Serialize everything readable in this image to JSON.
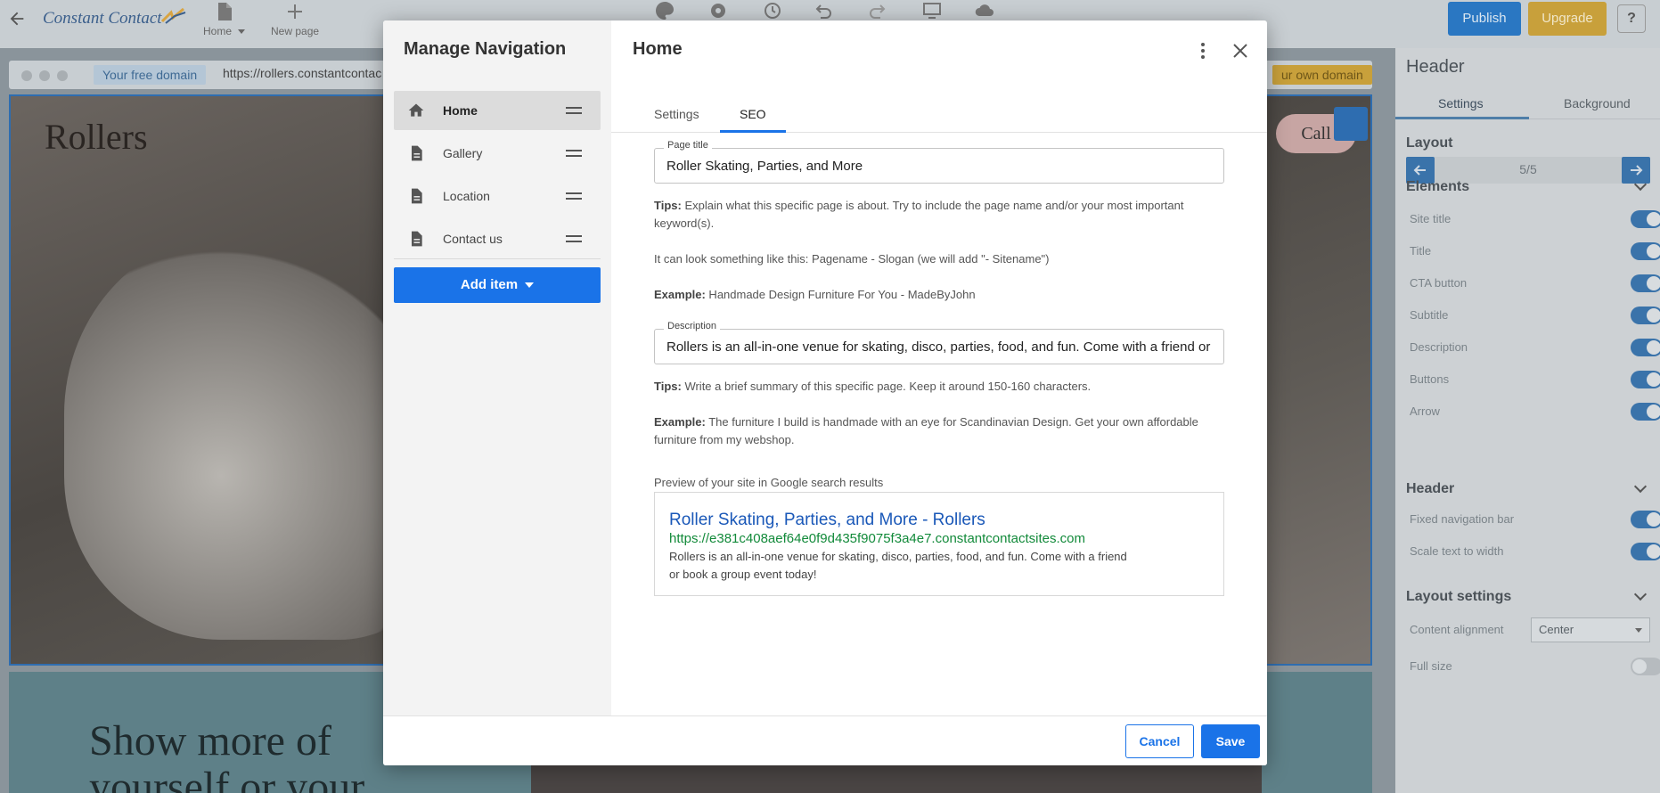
{
  "toolbar": {
    "logo_text": "Constant Contact",
    "page_menu_label": "Home",
    "new_page_label": "New page",
    "publish_label": "Publish",
    "upgrade_label": "Upgrade",
    "help_label": "?"
  },
  "canvas": {
    "free_domain_label": "Your free domain",
    "url": "https://rollers.constantcontac",
    "own_domain_label": "ur own domain",
    "hero_title": "Rollers",
    "hero_call": "Call",
    "below_text_line1": "Show more of",
    "below_text_line2": "yourself or your"
  },
  "right_panel": {
    "title": "Header",
    "tabs": [
      "Settings",
      "Background"
    ],
    "layout_label": "Layout",
    "layout_value": "5/5",
    "elements_label": "Elements",
    "elements": [
      {
        "label": "Site title",
        "on": true
      },
      {
        "label": "Title",
        "on": true
      },
      {
        "label": "CTA button",
        "on": true
      },
      {
        "label": "Subtitle",
        "on": true
      },
      {
        "label": "Description",
        "on": true
      },
      {
        "label": "Buttons",
        "on": true
      },
      {
        "label": "Arrow",
        "on": true
      }
    ],
    "header_label": "Header",
    "header_items": [
      {
        "label": "Fixed navigation bar",
        "on": true
      },
      {
        "label": "Scale text to width",
        "on": true
      }
    ],
    "layout_settings_label": "Layout settings",
    "content_alignment_label": "Content alignment",
    "content_alignment_value": "Center",
    "full_size_label": "Full size",
    "full_size_on": false
  },
  "modal": {
    "left_title": "Manage Navigation",
    "nav_items": [
      {
        "label": "Home",
        "icon": "home-icon",
        "active": true
      },
      {
        "label": "Gallery",
        "icon": "page-icon",
        "active": false
      },
      {
        "label": "Location",
        "icon": "page-icon",
        "active": false
      },
      {
        "label": "Contact us",
        "icon": "page-icon",
        "active": false
      }
    ],
    "add_item_label": "Add item",
    "right_title": "Home",
    "tabs": [
      "Settings",
      "SEO"
    ],
    "active_tab": "SEO",
    "page_title_label": "Page title",
    "page_title_value": "Roller Skating, Parties, and More",
    "tips1_bold": "Tips:",
    "tips1_text": " Explain what this specific page is about. Try to include the page name and/or your most important keyword(s).",
    "look_like_text": "It can look something like this: Pagename - Slogan (we will add \"- Sitename\")",
    "example1_bold": "Example:",
    "example1_text": " Handmade Design Furniture For You - MadeByJohn",
    "description_label": "Description",
    "description_value": "Rollers is an all-in-one venue for skating, disco, parties, food, and fun. Come with a friend or book a group event today!",
    "tips2_bold": "Tips:",
    "tips2_text": " Write a brief summary of this specific page. Keep it around 150-160 characters.",
    "example2_bold": "Example:",
    "example2_text": " The furniture I build is handmade with an eye for Scandinavian Design. Get your own affordable furniture from my webshop.",
    "preview_label": "Preview of your site in Google search results",
    "preview_title": "Roller Skating, Parties, and More - Rollers",
    "preview_url": "https://e381c408aef64e0f9d435f9075f3a4e7.constantcontactsites.com",
    "preview_desc": "Rollers is an all-in-one venue for skating, disco, parties, food, and fun. Come with a friend or book a group event today!",
    "cancel_label": "Cancel",
    "save_label": "Save"
  },
  "colors": {
    "primary": "#1a73e8",
    "preview_title": "#1a58b8",
    "preview_url": "#128a3a"
  }
}
